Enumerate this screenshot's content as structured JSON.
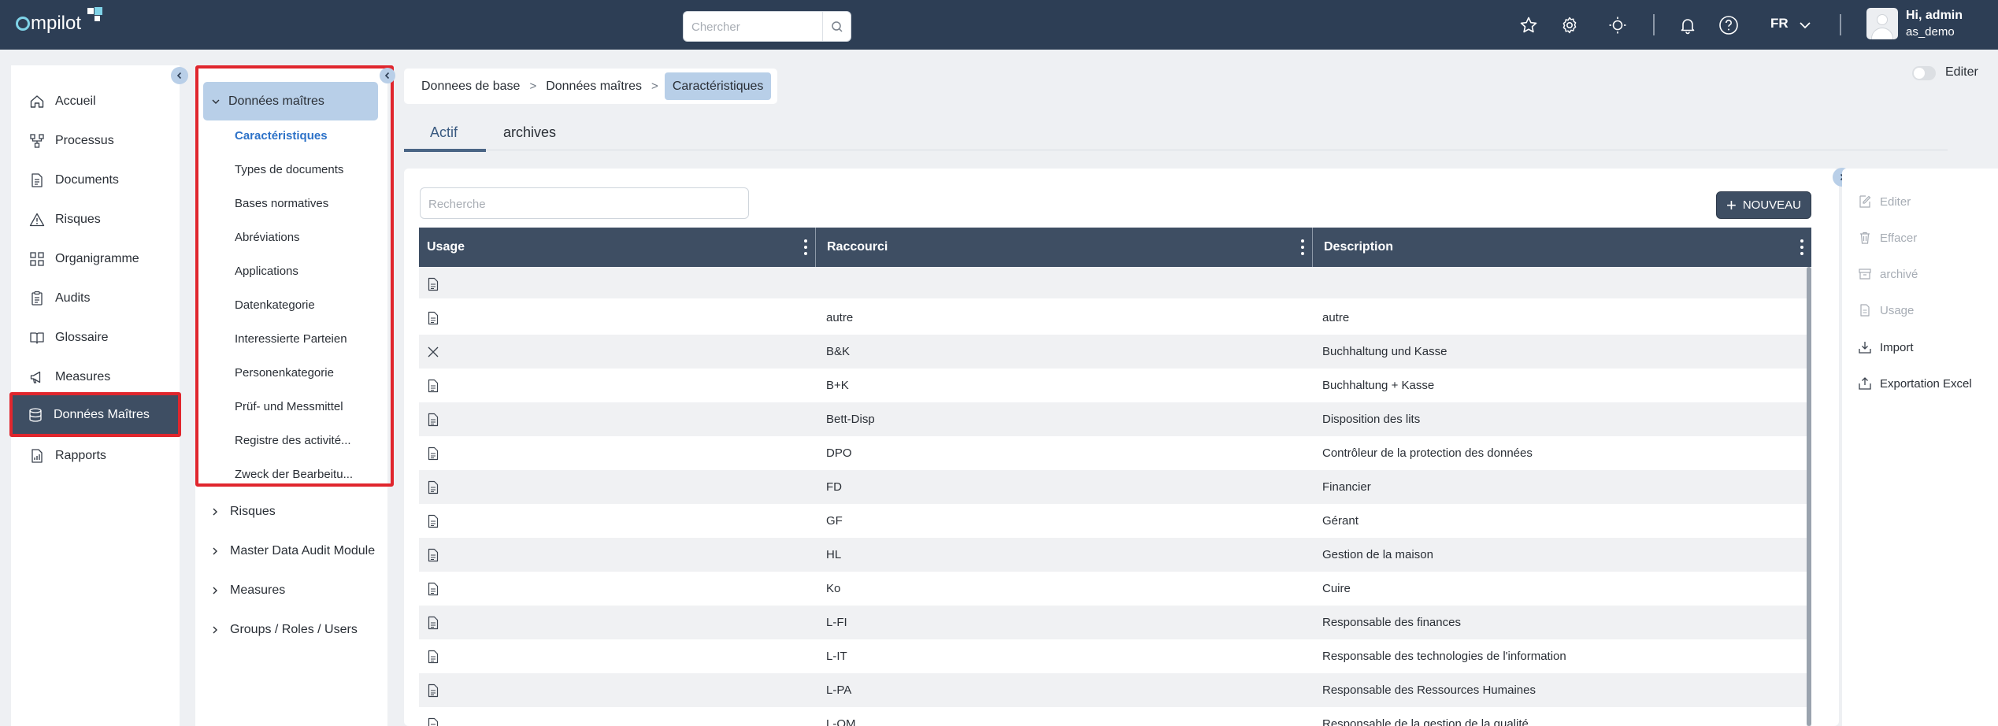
{
  "topbar": {
    "logo_text": "mpilot",
    "search_placeholder": "Chercher",
    "language": "FR",
    "user_greeting": "Hi, admin",
    "user_company": "as_demo",
    "icons": [
      "star-icon",
      "gear-icon",
      "sun-icon",
      "bell-icon",
      "help-icon",
      "chevron-down-icon"
    ]
  },
  "sidebar": {
    "items": [
      {
        "label": "Accueil",
        "icon": "home-icon"
      },
      {
        "label": "Processus",
        "icon": "process-icon"
      },
      {
        "label": "Documents",
        "icon": "document-icon"
      },
      {
        "label": "Risques",
        "icon": "warning-icon"
      },
      {
        "label": "Organigramme",
        "icon": "org-chart-icon"
      },
      {
        "label": "Audits",
        "icon": "clipboard-icon"
      },
      {
        "label": "Glossaire",
        "icon": "book-icon"
      },
      {
        "label": "Measures",
        "icon": "megaphone-icon"
      },
      {
        "label": "Données Maîtres",
        "icon": "database-icon",
        "active": true
      },
      {
        "label": "Rapports",
        "icon": "report-icon"
      }
    ]
  },
  "subnav": {
    "open_group": "Données maîtres",
    "open_items": [
      "Caractéristiques",
      "Types de documents",
      "Bases normatives",
      "Abréviations",
      "Applications",
      "Datenkategorie",
      "Interessierte Parteien",
      "Personenkategorie",
      "Prüf- und Messmittel",
      "Registre des activité...",
      "Zweck der Bearbeitu..."
    ],
    "selected": "Caractéristiques",
    "groups": [
      "Risques",
      "Master Data Audit Module",
      "Measures",
      "Groups / Roles / Users"
    ]
  },
  "breadcrumb": [
    "Donnees de base",
    "Données maîtres",
    "Caractéristiques"
  ],
  "edit_toggle_label": "Editer",
  "tabs": [
    {
      "label": "Actif",
      "active": true
    },
    {
      "label": "archives",
      "active": false
    }
  ],
  "table": {
    "search_placeholder": "Recherche",
    "new_button": "NOUVEAU",
    "columns": [
      "Usage",
      "Raccourci",
      "Description"
    ],
    "rows": [
      {
        "icon": "file-icon",
        "shortcut": "",
        "description": ""
      },
      {
        "icon": "file-icon",
        "shortcut": "autre",
        "description": "autre"
      },
      {
        "icon": "close-icon",
        "shortcut": "B&K",
        "description": "Buchhaltung und Kasse"
      },
      {
        "icon": "file-icon",
        "shortcut": "B+K",
        "description": "Buchhaltung + Kasse"
      },
      {
        "icon": "file-icon",
        "shortcut": "Bett-Disp",
        "description": "Disposition des lits"
      },
      {
        "icon": "file-icon",
        "shortcut": "DPO",
        "description": "Contrôleur de la protection des données"
      },
      {
        "icon": "file-icon",
        "shortcut": "FD",
        "description": "Financier"
      },
      {
        "icon": "file-icon",
        "shortcut": "GF",
        "description": "Gérant"
      },
      {
        "icon": "file-icon",
        "shortcut": "HL",
        "description": "Gestion de la maison"
      },
      {
        "icon": "file-icon",
        "shortcut": "Ko",
        "description": "Cuire"
      },
      {
        "icon": "file-icon",
        "shortcut": "L-FI",
        "description": "Responsable des finances"
      },
      {
        "icon": "file-icon",
        "shortcut": "L-IT",
        "description": "Responsable des technologies de l'information"
      },
      {
        "icon": "file-icon",
        "shortcut": "L-PA",
        "description": "Responsable des Ressources Humaines"
      },
      {
        "icon": "file-icon",
        "shortcut": "L-QM",
        "description": "Responsable de la gestion de la qualité"
      }
    ]
  },
  "actions": [
    {
      "label": "Editer",
      "icon": "edit-icon",
      "enabled": false
    },
    {
      "label": "Effacer",
      "icon": "trash-icon",
      "enabled": false
    },
    {
      "label": "archivé",
      "icon": "archive-icon",
      "enabled": false
    },
    {
      "label": "Usage",
      "icon": "file-icon",
      "enabled": false
    },
    {
      "label": "Import",
      "icon": "import-icon",
      "enabled": true
    },
    {
      "label": "Exportation Excel",
      "icon": "export-icon",
      "enabled": true
    }
  ],
  "colors": {
    "topbar": "#2d3e55",
    "active_nav": "#3e4e63",
    "highlight_box": "#e0262d",
    "selected_blue": "#2d72c8",
    "breadcrumb_active": "#b8cfe8"
  }
}
